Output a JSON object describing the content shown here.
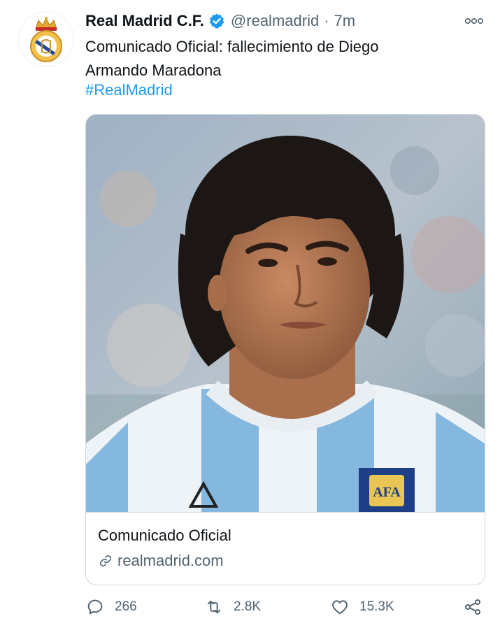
{
  "tweet": {
    "display_name": "Real Madrid C.F.",
    "handle": "@realmadrid",
    "separator": "·",
    "time": "7m",
    "text_line1": "Comunicado Oficial: fallecimiento de Diego",
    "text_line2": "Armando Maradona",
    "hashtag": "#RealMadrid"
  },
  "card": {
    "title": "Comunicado Oficial",
    "domain": "realmadrid.com",
    "image_subject": "photo-maradona-argentina-jersey"
  },
  "actions": {
    "replies": "266",
    "retweets": "2.8K",
    "likes": "15.3K"
  },
  "icons": {
    "verified": "verified-badge-icon",
    "more": "more-options-icon",
    "link": "link-icon",
    "reply": "reply-icon",
    "retweet": "retweet-icon",
    "like": "heart-icon",
    "share": "share-icon"
  },
  "colors": {
    "accent": "#1d9bf0",
    "secondary_text": "#536471",
    "primary_text": "#0f1419",
    "border": "#cfd9de"
  }
}
